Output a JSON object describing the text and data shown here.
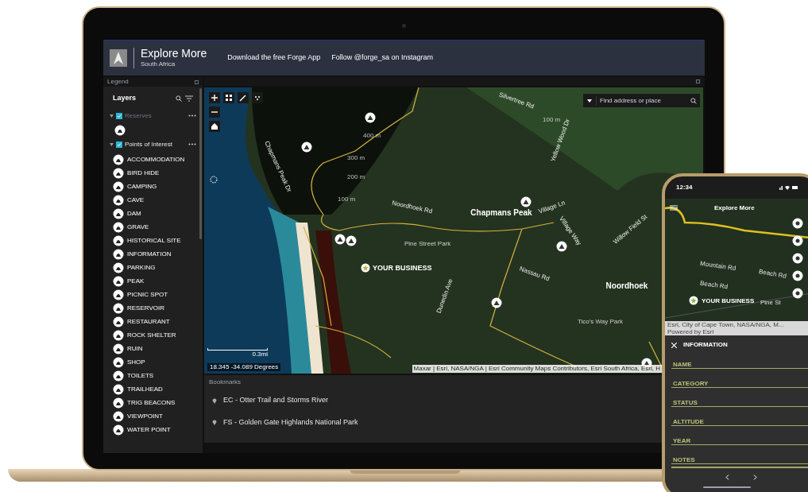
{
  "header": {
    "title": "Explore More",
    "subtitle": "South Africa",
    "links": [
      "Download the free Forge App",
      "Follow @forge_sa on Instagram"
    ]
  },
  "legend": {
    "title": "Legend",
    "heading": "Layers",
    "layers": [
      {
        "name": "Reserves",
        "kind": "single",
        "checked": true,
        "expanded": true,
        "dimmed": true
      },
      {
        "name": "Points of Interest",
        "kind": "list",
        "checked": true,
        "expanded": true,
        "dimmed": false,
        "items": [
          "ACCOMMODATION",
          "BIRD HIDE",
          "CAMPING",
          "CAVE",
          "DAM",
          "GRAVE",
          "HISTORICAL SITE",
          "INFORMATION",
          "PARKING",
          "PEAK",
          "PICNIC SPOT",
          "RESERVOIR",
          "RESTAURANT",
          "ROCK SHELTER",
          "RUIN",
          "SHOP",
          "TOILETS",
          "TRAILHEAD",
          "TRIG BEACONS",
          "VIEWPOINT",
          "WATER POINT"
        ]
      }
    ]
  },
  "map": {
    "search": {
      "placeholder": "Find address or place"
    },
    "labels": [
      {
        "text": "Silvertree Rd",
        "kind": "road"
      },
      {
        "text": "Chapmans Peak Dr",
        "kind": "road"
      },
      {
        "text": "400 m",
        "kind": "contour"
      },
      {
        "text": "300 m",
        "kind": "contour"
      },
      {
        "text": "200 m",
        "kind": "contour"
      },
      {
        "text": "100 m",
        "kind": "contour"
      },
      {
        "text": "100 m",
        "kind": "contour"
      },
      {
        "text": "Noordhoek Rd",
        "kind": "road"
      },
      {
        "text": "Chapmans Peak",
        "kind": "place"
      },
      {
        "text": "Yellow Wood Dr",
        "kind": "road"
      },
      {
        "text": "Village Ln",
        "kind": "road"
      },
      {
        "text": "Village Way",
        "kind": "road"
      },
      {
        "text": "Willow Field St",
        "kind": "road"
      },
      {
        "text": "Pine Street Park",
        "kind": "park"
      },
      {
        "text": "YOUR BUSINESS",
        "kind": "business"
      },
      {
        "text": "Nassau Rd",
        "kind": "road"
      },
      {
        "text": "Noordhoek",
        "kind": "place"
      },
      {
        "text": "Dunedin Ave",
        "kind": "road"
      },
      {
        "text": "Tico's Way Park",
        "kind": "park"
      }
    ],
    "scale": "0.3mi",
    "coordinates": "18.345 -34.089 Degrees",
    "attribution": "Maxar | Esri, NASA/NGA | Esri Community Maps Contributors, Esri South Africa, Esri, H"
  },
  "bookmarks": {
    "title": "Bookmarks",
    "items": [
      "EC - Otter Trail and Storms River",
      "FS - Golden Gate Highlands National Park"
    ]
  },
  "phone": {
    "time": "12:34",
    "title": "Explore More",
    "labels": [
      {
        "text": "Mountain Rd",
        "kind": "road"
      },
      {
        "text": "Beach Rd",
        "kind": "road"
      },
      {
        "text": "Beach Rd",
        "kind": "road"
      },
      {
        "text": "YOUR BUSINESS",
        "kind": "business"
      },
      {
        "text": "Pine St",
        "kind": "park"
      }
    ],
    "attribution": "Esri, City of Cape Town, NASA/NGA, M...",
    "powered": "Powered by Esri",
    "panel": {
      "title": "INFORMATION",
      "fields": [
        "NAME",
        "CATEGORY",
        "STATUS",
        "ALTITUDE",
        "YEAR",
        "NOTES"
      ]
    }
  }
}
